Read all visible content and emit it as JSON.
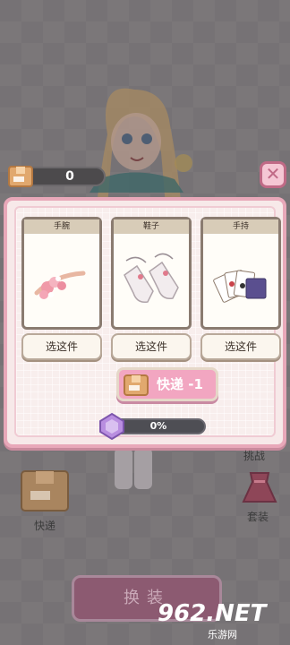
{
  "top_bar": {
    "box_count": "0"
  },
  "close_label": "✕",
  "slots": [
    {
      "name": "手腕",
      "icon": "bracelet-icon",
      "button": "选这件"
    },
    {
      "name": "鞋子",
      "icon": "shoes-icon",
      "button": "选这件"
    },
    {
      "name": "手持",
      "icon": "cards-icon",
      "button": "选这件"
    }
  ],
  "express_button": {
    "label": "快递 -1"
  },
  "progress": {
    "value_text": "0%",
    "value": 0
  },
  "shortcuts": {
    "express_label": "快递",
    "challenge_label": "挑战",
    "outfit_label": "套装"
  },
  "dress_button_label": "换装",
  "watermark": {
    "brand": "962.NET",
    "sub": "乐游网"
  },
  "colors": {
    "accent_pink": "#f2a6c1",
    "frame_pink": "#e8a8b9",
    "progress_purple": "#b98ee0"
  }
}
